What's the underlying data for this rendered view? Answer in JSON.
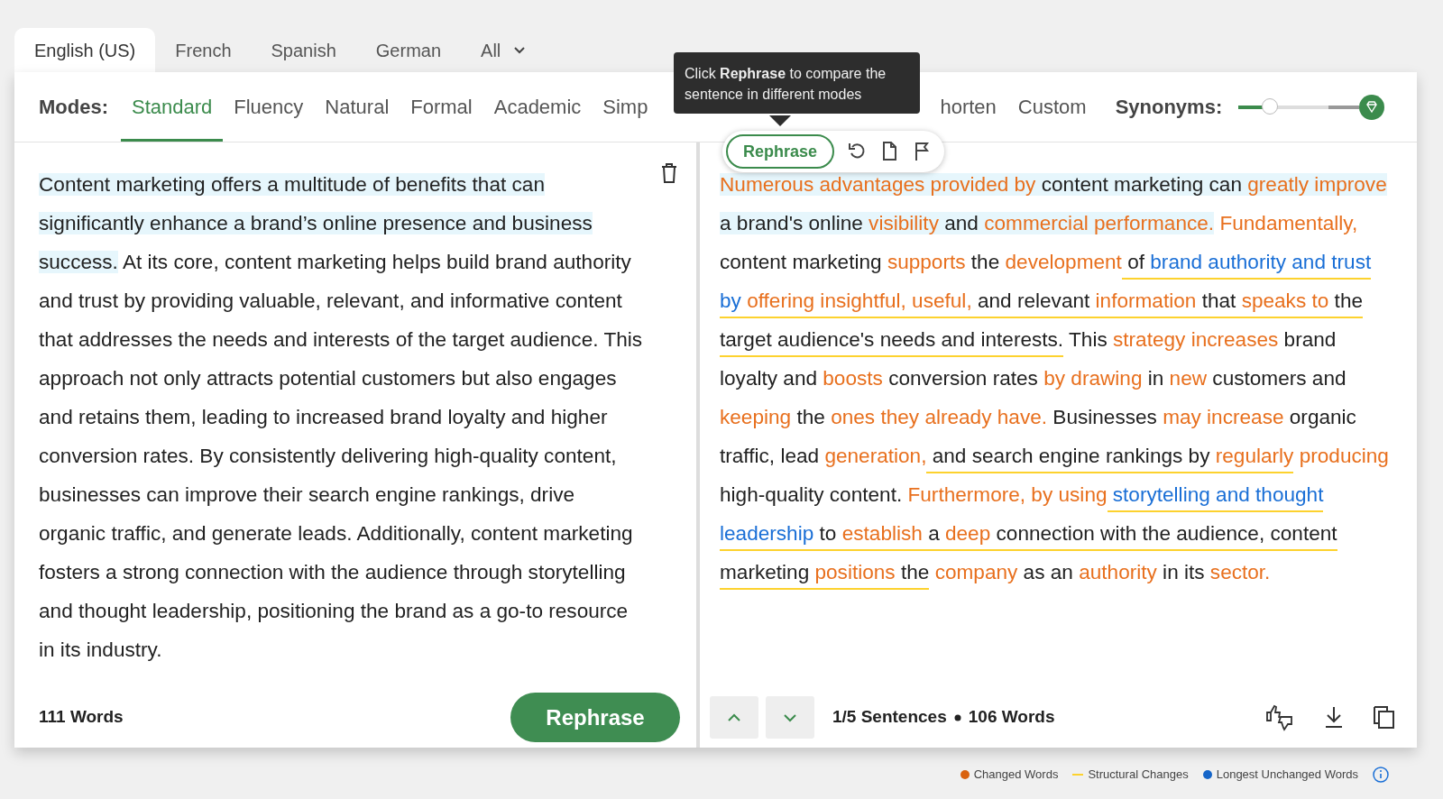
{
  "language_tabs": [
    {
      "label": "English (US)",
      "selected": true,
      "kind": "tab"
    },
    {
      "label": "French",
      "selected": false,
      "kind": "tab"
    },
    {
      "label": "Spanish",
      "selected": false,
      "kind": "tab"
    },
    {
      "label": "German",
      "selected": false,
      "kind": "tab"
    },
    {
      "label": "All",
      "selected": false,
      "kind": "dropdown"
    }
  ],
  "modes": {
    "label": "Modes:",
    "items": [
      {
        "label": "Standard",
        "selected": true
      },
      {
        "label": "Fluency",
        "selected": false
      },
      {
        "label": "Natural",
        "selected": false
      },
      {
        "label": "Formal",
        "selected": false
      },
      {
        "label": "Academic",
        "selected": false
      },
      {
        "label": "Simp",
        "selected": false
      },
      {
        "label": "horten",
        "selected": false
      },
      {
        "label": "Custom",
        "selected": false
      }
    ]
  },
  "tooltip": {
    "text": "Click **Rephrase** to compare the sentence in different modes"
  },
  "synonyms": {
    "label": "Synonyms:",
    "level": 0.35
  },
  "input": {
    "sentences": [
      {
        "text": "Content marketing offers a multitude of benefits that can significantly enhance a brand’s online presence and business success.",
        "selected": true
      },
      {
        "text": "At its core, content marketing helps build brand authority and trust by providing valuable, relevant, and informative content that addresses the needs and interests of the target audience.",
        "selected": false
      },
      {
        "text": "This approach not only attracts potential customers but also engages and retains them, leading to increased brand loyalty and higher conversion rates.",
        "selected": false
      },
      {
        "text": "By consistently delivering high-quality content, businesses can improve their search engine rankings, drive organic traffic, and generate leads.",
        "selected": false
      },
      {
        "text": "Additionally, content marketing fosters a strong connection with the audience through storytelling and thought leadership, positioning the brand as a go-to resource in its industry.",
        "selected": false
      }
    ],
    "word_count": "111 Words",
    "button": "Rephrase"
  },
  "output": {
    "toolbar": {
      "button": "Rephrase"
    },
    "sentences": [
      {
        "selected": true,
        "segments": [
          {
            "text": "Numerous advantages provided by",
            "kind": "changed",
            "structural": false
          },
          {
            "text": " content marketing can ",
            "kind": "plain",
            "structural": false
          },
          {
            "text": "greatly improve",
            "kind": "changed",
            "structural": false
          },
          {
            "text": " a brand's online ",
            "kind": "plain",
            "structural": false
          },
          {
            "text": "visibility",
            "kind": "changed",
            "structural": false
          },
          {
            "text": " and ",
            "kind": "plain",
            "structural": false
          },
          {
            "text": "commercial performance.",
            "kind": "changed",
            "structural": false
          }
        ]
      },
      {
        "selected": false,
        "segments": [
          {
            "text": "Fundamentally,",
            "kind": "changed",
            "structural": false
          },
          {
            "text": " content marketing ",
            "kind": "plain",
            "structural": false
          },
          {
            "text": "supports",
            "kind": "changed",
            "structural": false
          },
          {
            "text": " the ",
            "kind": "plain",
            "structural": false
          },
          {
            "text": "development",
            "kind": "changed",
            "structural": false
          },
          {
            "text": " of ",
            "kind": "plain",
            "structural": true
          },
          {
            "text": "brand authority and trust by ",
            "kind": "longest",
            "structural": true
          },
          {
            "text": "offering insightful, useful,",
            "kind": "changed",
            "structural": true
          },
          {
            "text": " and relevant ",
            "kind": "plain",
            "structural": true
          },
          {
            "text": "information",
            "kind": "changed",
            "structural": true
          },
          {
            "text": " that ",
            "kind": "plain",
            "structural": true
          },
          {
            "text": "speaks to",
            "kind": "changed",
            "structural": true
          },
          {
            "text": " the target audience's needs and interests.",
            "kind": "plain",
            "structural": true
          }
        ]
      },
      {
        "selected": false,
        "segments": [
          {
            "text": "This ",
            "kind": "plain",
            "structural": false
          },
          {
            "text": "strategy increases",
            "kind": "changed",
            "structural": false
          },
          {
            "text": " brand loyalty and ",
            "kind": "plain",
            "structural": false
          },
          {
            "text": "boosts",
            "kind": "changed",
            "structural": false
          },
          {
            "text": " conversion rates ",
            "kind": "plain",
            "structural": false
          },
          {
            "text": "by drawing",
            "kind": "changed",
            "structural": false
          },
          {
            "text": " in ",
            "kind": "plain",
            "structural": false
          },
          {
            "text": "new",
            "kind": "changed",
            "structural": false
          },
          {
            "text": " customers and ",
            "kind": "plain",
            "structural": false
          },
          {
            "text": "keeping",
            "kind": "changed",
            "structural": false
          },
          {
            "text": " the ",
            "kind": "plain",
            "structural": false
          },
          {
            "text": "ones they already have.",
            "kind": "changed",
            "structural": false
          }
        ]
      },
      {
        "selected": false,
        "segments": [
          {
            "text": "Businesses ",
            "kind": "plain",
            "structural": false
          },
          {
            "text": "may increase",
            "kind": "changed",
            "structural": false
          },
          {
            "text": " organic traffic, lead ",
            "kind": "plain",
            "structural": false
          },
          {
            "text": "generation,",
            "kind": "changed",
            "structural": false
          },
          {
            "text": " and search engine rankings by ",
            "kind": "plain",
            "structural": true
          },
          {
            "text": "regularly",
            "kind": "changed",
            "structural": true
          },
          {
            "text": " producing",
            "kind": "changed",
            "structural": false
          },
          {
            "text": " high-quality content.",
            "kind": "plain",
            "structural": false
          }
        ]
      },
      {
        "selected": false,
        "segments": [
          {
            "text": "Furthermore, by using",
            "kind": "changed",
            "structural": false
          },
          {
            "text": " storytelling and thought leadership",
            "kind": "longest",
            "structural": true
          },
          {
            "text": " to ",
            "kind": "plain",
            "structural": true
          },
          {
            "text": "establish",
            "kind": "changed",
            "structural": true
          },
          {
            "text": " a ",
            "kind": "plain",
            "structural": true
          },
          {
            "text": "deep",
            "kind": "changed",
            "structural": true
          },
          {
            "text": " connection with the audience, content marketing ",
            "kind": "plain",
            "structural": true
          },
          {
            "text": "positions",
            "kind": "changed",
            "structural": true
          },
          {
            "text": " the",
            "kind": "plain",
            "structural": true
          },
          {
            "text": " company",
            "kind": "changed",
            "structural": false
          },
          {
            "text": " as an ",
            "kind": "plain",
            "structural": false
          },
          {
            "text": "authority",
            "kind": "changed",
            "structural": false
          },
          {
            "text": " in its ",
            "kind": "plain",
            "structural": false
          },
          {
            "text": "sector.",
            "kind": "changed",
            "structural": false
          }
        ]
      }
    ],
    "pager": "1/5 Sentences",
    "word_count": "106 Words"
  },
  "legend": [
    {
      "label": "Changed Words",
      "kind": "dot",
      "color": "#d9620f"
    },
    {
      "label": "Structural Changes",
      "kind": "line",
      "color": "#fdd22e"
    },
    {
      "label": "Longest Unchanged Words",
      "kind": "dot",
      "color": "#1565c8"
    }
  ]
}
